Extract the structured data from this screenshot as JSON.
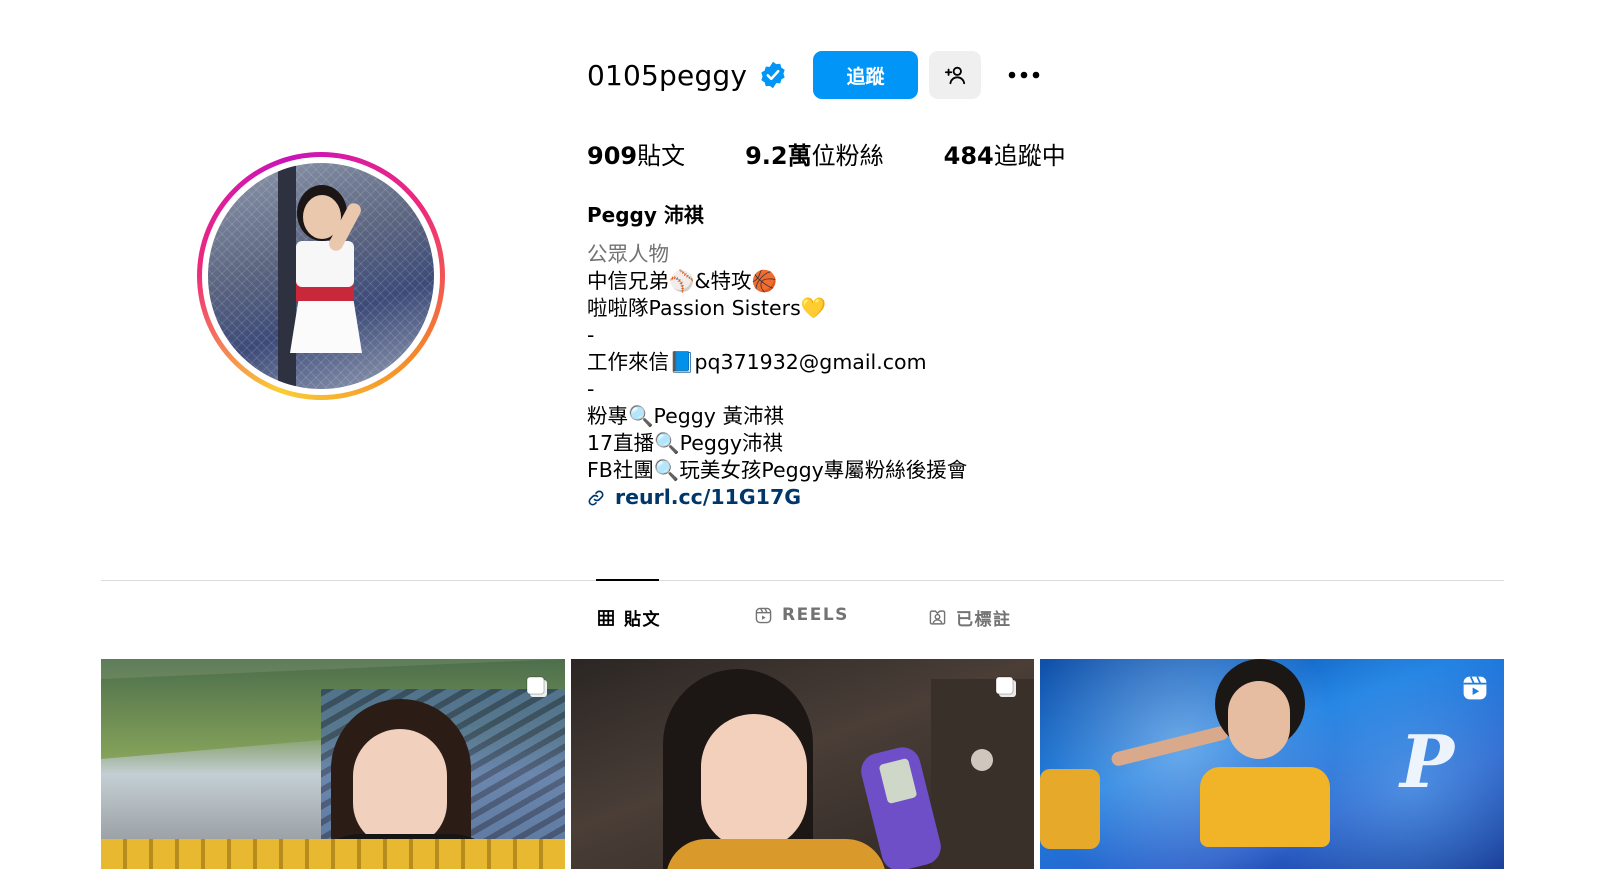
{
  "profile": {
    "username": "0105peggy",
    "follow_label": "追蹤",
    "stats": {
      "posts_count": "909",
      "posts_label": "貼文",
      "followers_count": "9.2萬",
      "followers_label": "位粉絲",
      "following_count": "484",
      "following_label": "追蹤中"
    },
    "full_name": "Peggy 沛祺",
    "category": "公眾人物",
    "bio_lines": [
      "中信兄弟⚾&特攻🏀",
      "啦啦隊Passion Sisters💛",
      "-",
      "工作來信📘pq371932@gmail.com",
      "-",
      "粉專🔍Peggy 黃沛祺",
      "17直播🔍Peggy沛祺",
      "FB社團🔍玩美女孩Peggy專屬粉絲後援會"
    ],
    "link": "reurl.cc/11G17G"
  },
  "tabs": [
    {
      "label": "貼文",
      "icon": "grid-icon",
      "active": true
    },
    {
      "label": "REELS",
      "icon": "reels-icon",
      "active": false
    },
    {
      "label": "已標註",
      "icon": "tagged-icon",
      "active": false
    }
  ],
  "posts": [
    {
      "type": "carousel",
      "icon": "carousel-icon"
    },
    {
      "type": "carousel",
      "icon": "carousel-icon"
    },
    {
      "type": "reel",
      "icon": "reels-icon"
    }
  ],
  "colors": {
    "accent": "#0095f6",
    "link": "#00376b",
    "muted": "#737373",
    "verified": "#0095f6"
  }
}
